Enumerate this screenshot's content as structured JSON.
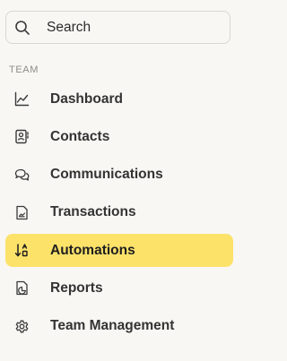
{
  "search": {
    "placeholder": "Search",
    "icon": "search-icon"
  },
  "section": {
    "label": "TEAM"
  },
  "nav": {
    "items": [
      {
        "label": "Dashboard",
        "icon": "chart-line-icon",
        "active": false
      },
      {
        "label": "Contacts",
        "icon": "contact-card-icon",
        "active": false
      },
      {
        "label": "Communications",
        "icon": "chat-bubbles-icon",
        "active": false
      },
      {
        "label": "Transactions",
        "icon": "document-image-icon",
        "active": false
      },
      {
        "label": "Automations",
        "icon": "sort-arrows-icon",
        "active": true
      },
      {
        "label": "Reports",
        "icon": "report-document-icon",
        "active": false
      },
      {
        "label": "Team Management",
        "icon": "gear-icon",
        "active": false
      }
    ]
  },
  "colors": {
    "background": "#f8f7f4",
    "active_highlight": "#fde26a",
    "text": "#333333",
    "muted_text": "#8e8c87"
  }
}
